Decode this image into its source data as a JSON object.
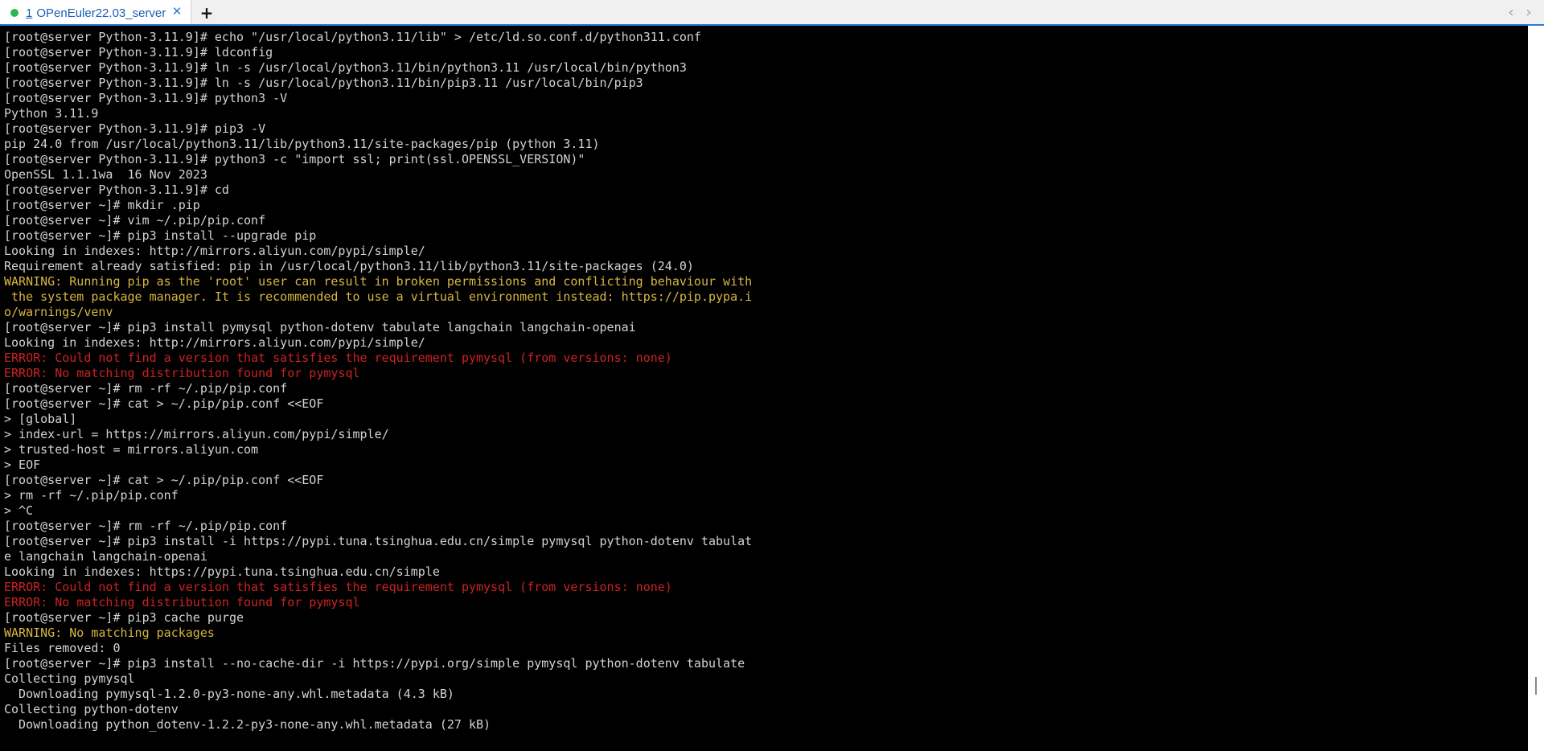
{
  "tab": {
    "number": "1",
    "title": "OPenEuler22.03_server",
    "status_color": "#2db84d",
    "close_glyph": "✕"
  },
  "toolbar": {
    "new_tab_glyph": "+",
    "prev_glyph": "‹",
    "next_glyph": "›"
  },
  "terminal": {
    "colors": {
      "normal": "#d3d3d3",
      "warning": "#d7b640",
      "error": "#cc2222"
    },
    "lines": [
      {
        "text": "[root@server Python-3.11.9]# echo \"/usr/local/python3.11/lib\" > /etc/ld.so.conf.d/python311.conf",
        "style": "normal"
      },
      {
        "text": "[root@server Python-3.11.9]# ldconfig",
        "style": "normal"
      },
      {
        "text": "[root@server Python-3.11.9]# ln -s /usr/local/python3.11/bin/python3.11 /usr/local/bin/python3",
        "style": "normal"
      },
      {
        "text": "[root@server Python-3.11.9]# ln -s /usr/local/python3.11/bin/pip3.11 /usr/local/bin/pip3",
        "style": "normal"
      },
      {
        "text": "[root@server Python-3.11.9]# python3 -V",
        "style": "normal"
      },
      {
        "text": "Python 3.11.9",
        "style": "normal"
      },
      {
        "text": "[root@server Python-3.11.9]# pip3 -V",
        "style": "normal"
      },
      {
        "text": "pip 24.0 from /usr/local/python3.11/lib/python3.11/site-packages/pip (python 3.11)",
        "style": "normal"
      },
      {
        "text": "[root@server Python-3.11.9]# python3 -c \"import ssl; print(ssl.OPENSSL_VERSION)\"",
        "style": "normal"
      },
      {
        "text": "OpenSSL 1.1.1wa  16 Nov 2023",
        "style": "normal"
      },
      {
        "text": "[root@server Python-3.11.9]# cd",
        "style": "normal"
      },
      {
        "text": "[root@server ~]# mkdir .pip",
        "style": "normal"
      },
      {
        "text": "[root@server ~]# vim ~/.pip/pip.conf",
        "style": "normal"
      },
      {
        "text": "[root@server ~]# pip3 install --upgrade pip",
        "style": "normal"
      },
      {
        "text": "Looking in indexes: http://mirrors.aliyun.com/pypi/simple/",
        "style": "normal"
      },
      {
        "text": "Requirement already satisfied: pip in /usr/local/python3.11/lib/python3.11/site-packages (24.0)",
        "style": "normal"
      },
      {
        "text": "WARNING: Running pip as the 'root' user can result in broken permissions and conflicting behaviour with",
        "style": "warning"
      },
      {
        "text": " the system package manager. It is recommended to use a virtual environment instead: https://pip.pypa.i",
        "style": "warning"
      },
      {
        "text": "o/warnings/venv",
        "style": "warning"
      },
      {
        "text": "[root@server ~]# pip3 install pymysql python-dotenv tabulate langchain langchain-openai",
        "style": "normal"
      },
      {
        "text": "Looking in indexes: http://mirrors.aliyun.com/pypi/simple/",
        "style": "normal"
      },
      {
        "text": "ERROR: Could not find a version that satisfies the requirement pymysql (from versions: none)",
        "style": "error"
      },
      {
        "text": "ERROR: No matching distribution found for pymysql",
        "style": "error"
      },
      {
        "text": "[root@server ~]# rm -rf ~/.pip/pip.conf",
        "style": "normal"
      },
      {
        "text": "[root@server ~]# cat > ~/.pip/pip.conf <<EOF",
        "style": "normal"
      },
      {
        "text": "> [global]",
        "style": "normal"
      },
      {
        "text": "> index-url = https://mirrors.aliyun.com/pypi/simple/",
        "style": "normal"
      },
      {
        "text": "> trusted-host = mirrors.aliyun.com",
        "style": "normal"
      },
      {
        "text": "> EOF",
        "style": "normal"
      },
      {
        "text": "[root@server ~]# cat > ~/.pip/pip.conf <<EOF",
        "style": "normal"
      },
      {
        "text": "> rm -rf ~/.pip/pip.conf",
        "style": "normal"
      },
      {
        "text": "> ^C",
        "style": "normal"
      },
      {
        "text": "[root@server ~]# rm -rf ~/.pip/pip.conf",
        "style": "normal"
      },
      {
        "text": "[root@server ~]# pip3 install -i https://pypi.tuna.tsinghua.edu.cn/simple pymysql python-dotenv tabulat",
        "style": "normal"
      },
      {
        "text": "e langchain langchain-openai",
        "style": "normal"
      },
      {
        "text": "Looking in indexes: https://pypi.tuna.tsinghua.edu.cn/simple",
        "style": "normal"
      },
      {
        "text": "ERROR: Could not find a version that satisfies the requirement pymysql (from versions: none)",
        "style": "error"
      },
      {
        "text": "ERROR: No matching distribution found for pymysql",
        "style": "error"
      },
      {
        "text": "[root@server ~]# pip3 cache purge",
        "style": "normal"
      },
      {
        "text": "WARNING: No matching packages",
        "style": "warning"
      },
      {
        "text": "Files removed: 0",
        "style": "normal"
      },
      {
        "text": "[root@server ~]# pip3 install --no-cache-dir -i https://pypi.org/simple pymysql python-dotenv tabulate",
        "style": "normal"
      },
      {
        "text": "Collecting pymysql",
        "style": "normal"
      },
      {
        "text": "  Downloading pymysql-1.2.0-py3-none-any.whl.metadata (4.3 kB)",
        "style": "normal"
      },
      {
        "text": "Collecting python-dotenv",
        "style": "normal"
      },
      {
        "text": "  Downloading python_dotenv-1.2.2-py3-none-any.whl.metadata (27 kB)",
        "style": "normal"
      }
    ]
  }
}
